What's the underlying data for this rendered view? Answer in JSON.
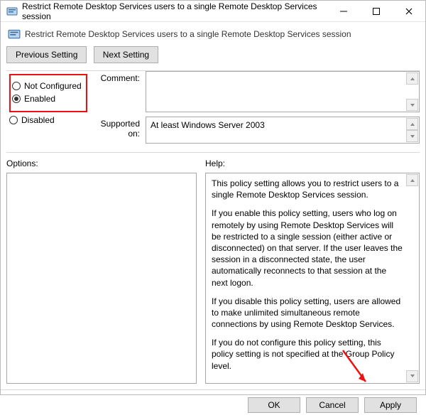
{
  "window": {
    "title": "Restrict Remote Desktop Services users to a single Remote Desktop Services session"
  },
  "header": {
    "heading": "Restrict Remote Desktop Services users to a single Remote Desktop Services session"
  },
  "nav": {
    "previous": "Previous Setting",
    "next": "Next Setting"
  },
  "state": {
    "not_configured": "Not Configured",
    "enabled": "Enabled",
    "disabled": "Disabled",
    "selected": "enabled"
  },
  "fields": {
    "comment_label": "Comment:",
    "comment_value": "",
    "supported_label": "Supported on:",
    "supported_value": "At least Windows Server 2003"
  },
  "panes": {
    "options_label": "Options:",
    "help_label": "Help:"
  },
  "help": {
    "p1": "This policy setting allows you to restrict users to a single Remote Desktop Services session.",
    "p2": "If you enable this policy setting, users who log on remotely by using Remote Desktop Services will be restricted to a single session (either active or disconnected) on that server. If the user leaves the session in a disconnected state, the user automatically reconnects to that session at the next logon.",
    "p3": "If you disable this policy setting, users are allowed to make unlimited simultaneous remote connections by using Remote Desktop Services.",
    "p4": "If you do not configure this policy setting,  this policy setting is not specified at the Group Policy level."
  },
  "footer": {
    "ok": "OK",
    "cancel": "Cancel",
    "apply": "Apply"
  }
}
